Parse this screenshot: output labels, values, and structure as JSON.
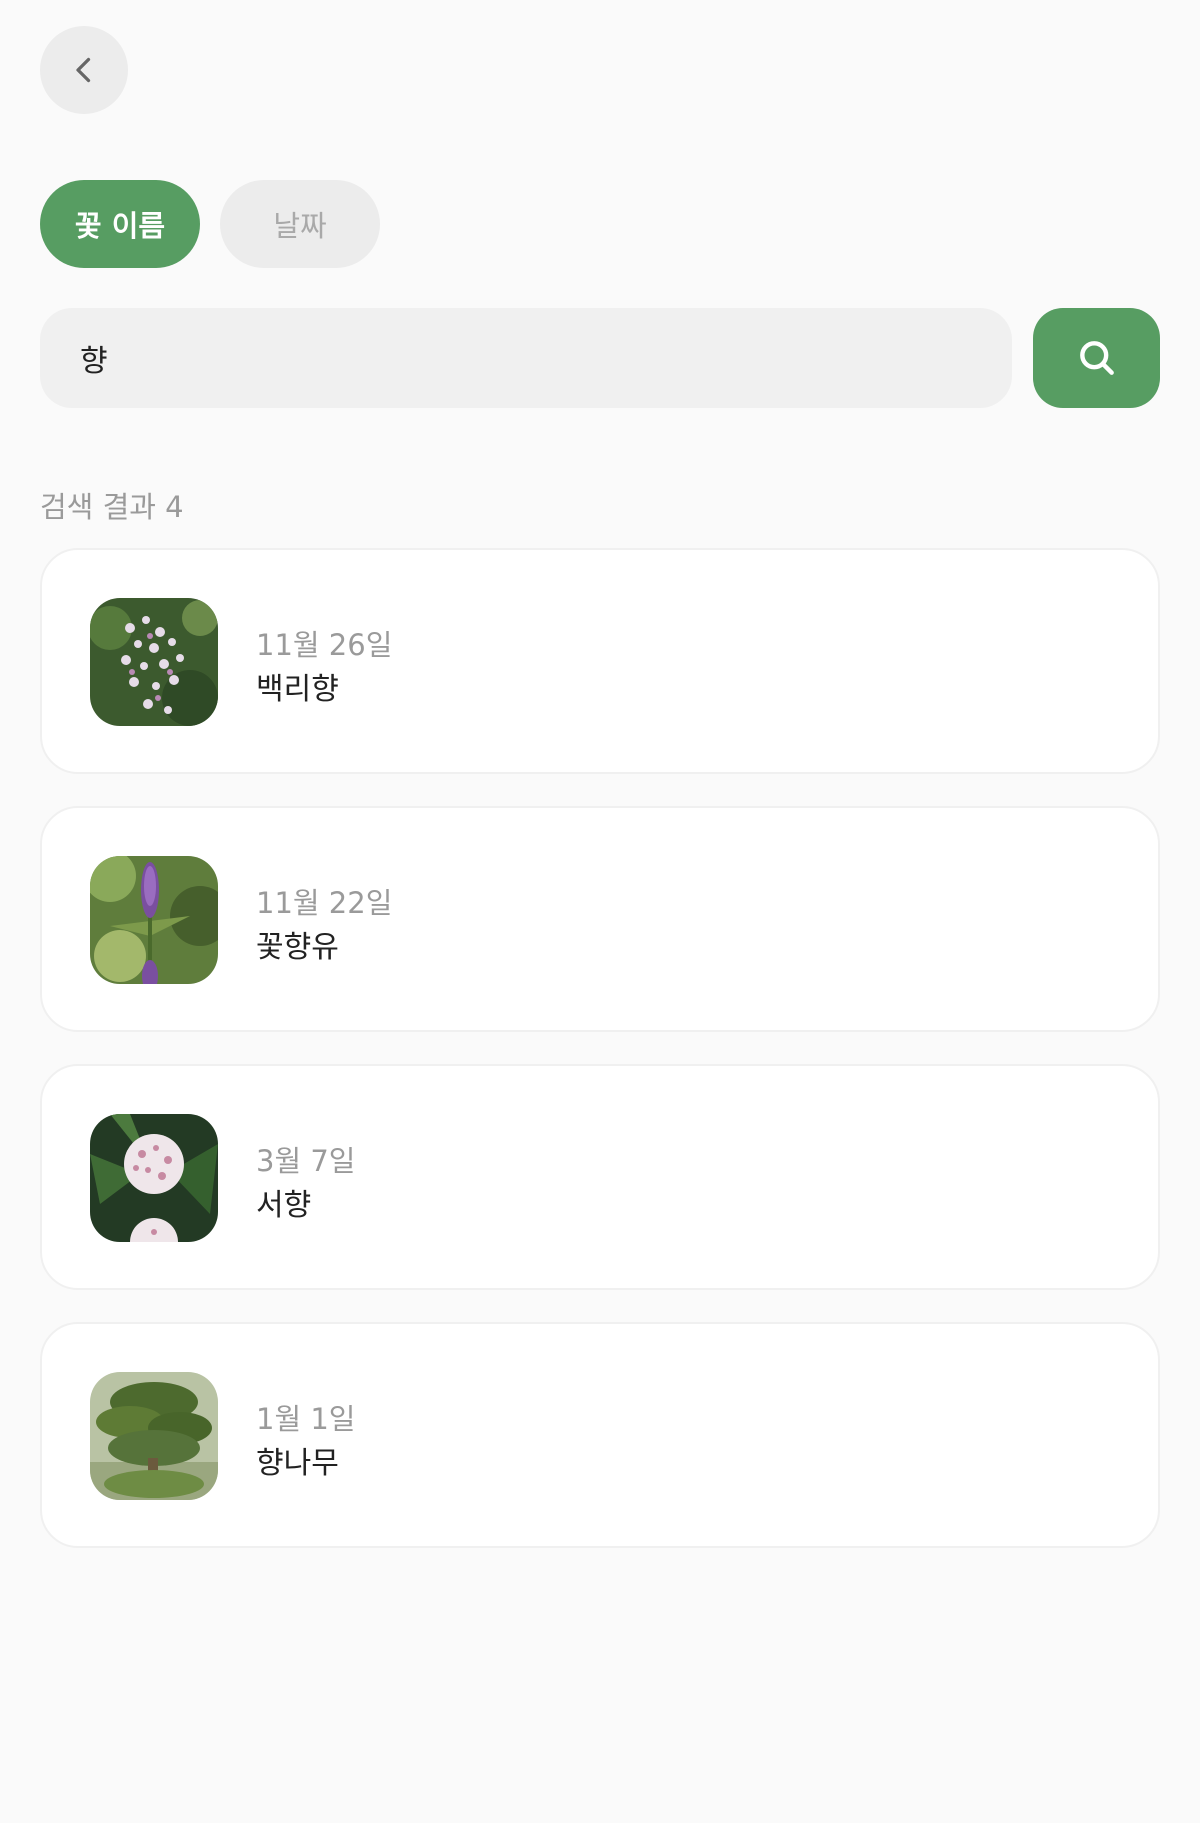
{
  "header": {
    "back_icon": "chevron-left-icon"
  },
  "tabs": [
    {
      "label": "꽃 이름",
      "active": true
    },
    {
      "label": "날짜",
      "active": false
    }
  ],
  "search": {
    "value": "향",
    "icon": "search-icon"
  },
  "results": {
    "count_text": "검색 결과 4",
    "items": [
      {
        "date": "11월 26일",
        "name": "백리향"
      },
      {
        "date": "11월 22일",
        "name": "꽃향유"
      },
      {
        "date": "3월 7일",
        "name": "서향"
      },
      {
        "date": "1월 1일",
        "name": "향나무"
      }
    ]
  },
  "colors": {
    "accent": "#579d62",
    "background": "#fafafa",
    "chip_inactive": "#ececec",
    "input_background": "#f0f0f0",
    "muted_text": "#9a9a9a"
  }
}
